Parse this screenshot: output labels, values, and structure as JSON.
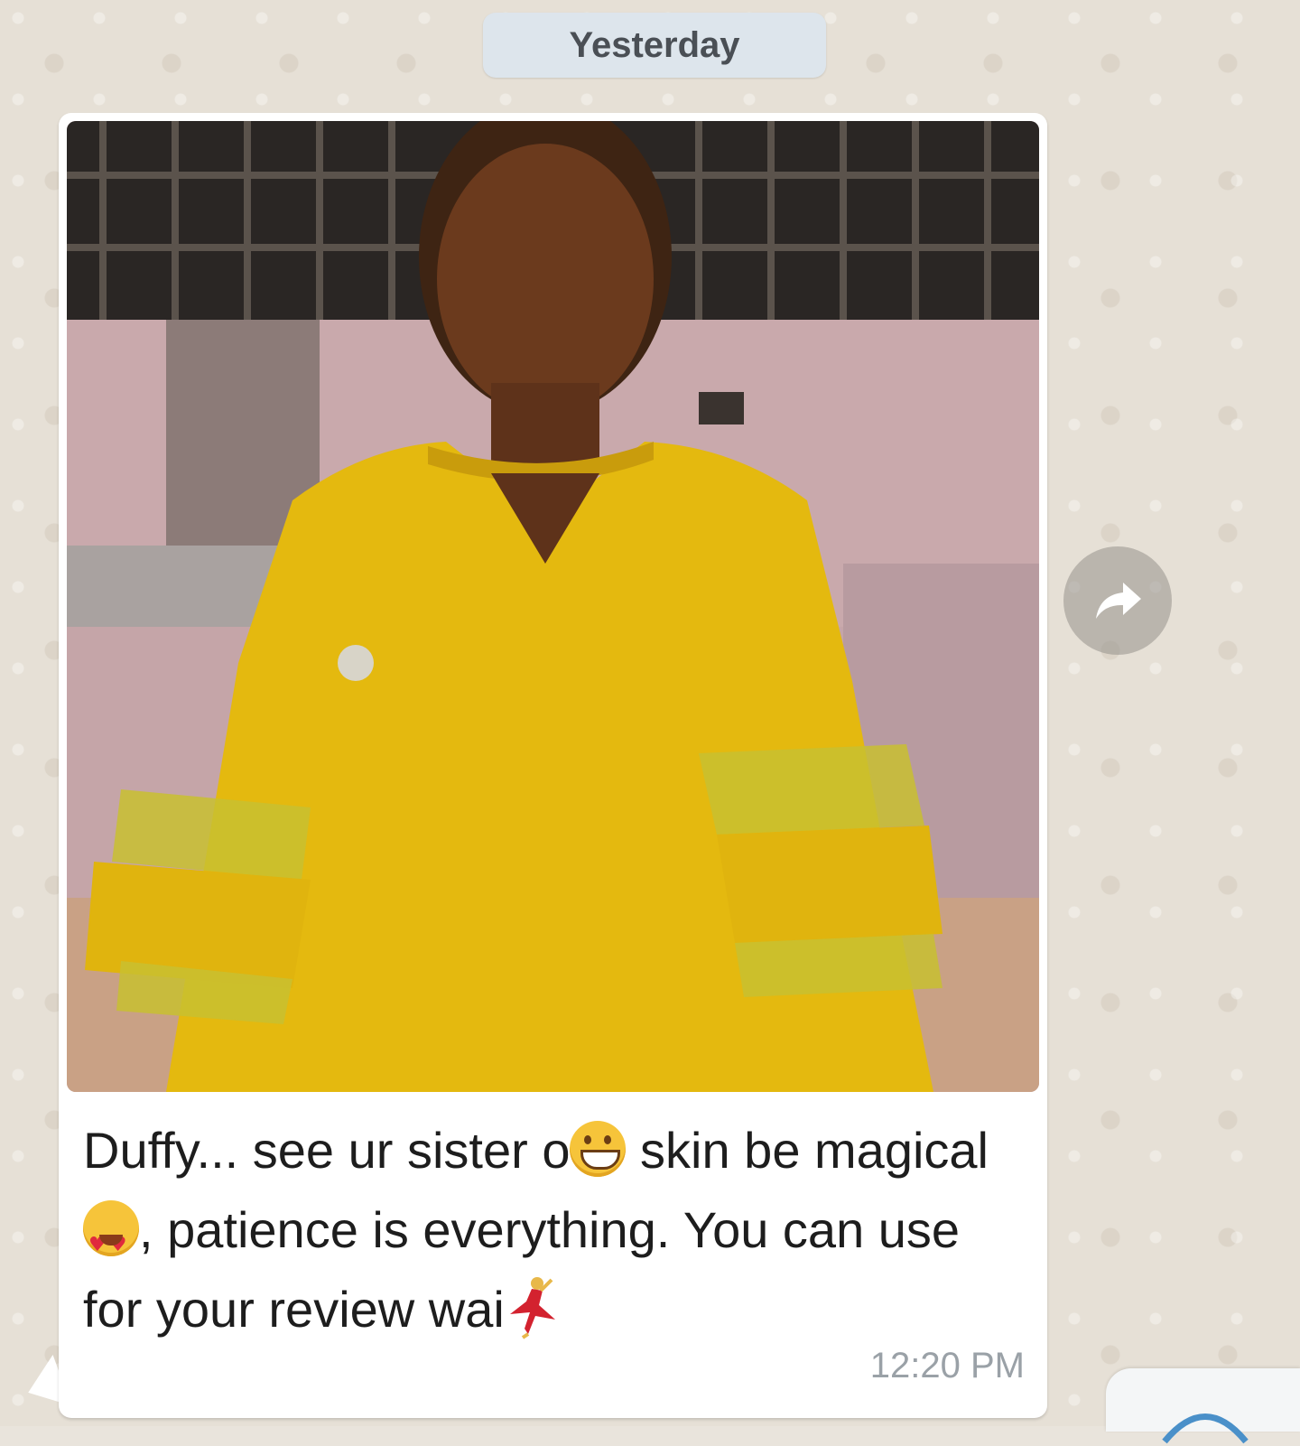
{
  "chat": {
    "date_separator": "Yesterday",
    "message": {
      "text_part1": "Duffy... see ur sister o",
      "emoji1": "grinning-face",
      "text_part2": "skin be magical ",
      "emoji2": "heart-eyes-face",
      "text_part3": ", patience is everything. You can use for your review wai",
      "emoji3": "dancer",
      "time": "12:20 PM"
    },
    "photo": {
      "icon": "photo-attachment"
    }
  },
  "colors": {
    "chat_background": "#e6e0d6",
    "bubble": "#ffffff",
    "date_chip": "#dde5ec",
    "timestamp": "#9aa1a7",
    "dress_yellow": "#e4b90f"
  },
  "icons": {
    "forward": "forward-arrow-icon",
    "partial_fab": "partial-circle-icon"
  }
}
